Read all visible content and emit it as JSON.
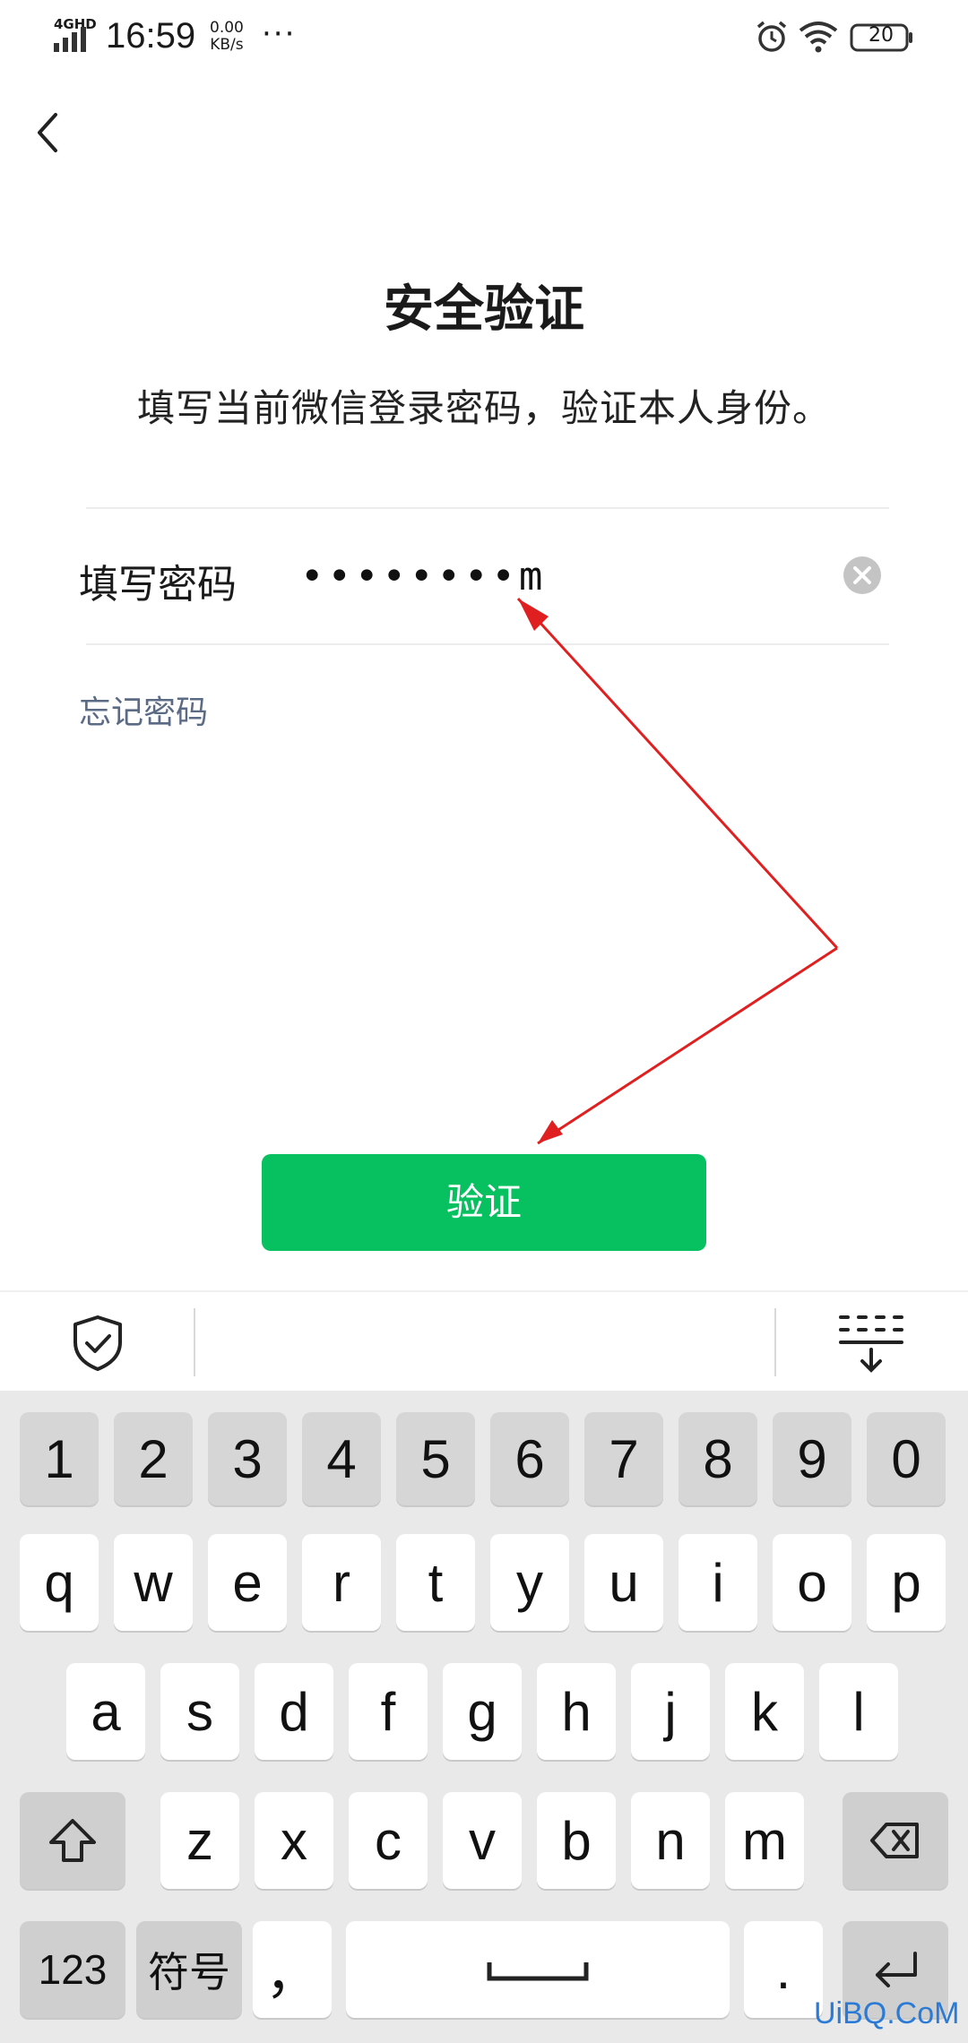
{
  "status_bar": {
    "network": "4GHD",
    "time": "16:59",
    "speed_value": "0.00",
    "speed_unit": "KB/s",
    "more": "···",
    "battery": "20"
  },
  "header": {
    "title": "安全验证",
    "subtitle": "填写当前微信登录密码，验证本人身份。"
  },
  "form": {
    "password_label": "填写密码",
    "password_value": "••••••••m",
    "forgot_link": "忘记密码",
    "verify_button": "验证"
  },
  "keyboard": {
    "row_numbers": [
      "1",
      "2",
      "3",
      "4",
      "5",
      "6",
      "7",
      "8",
      "9",
      "0"
    ],
    "row1": [
      "q",
      "w",
      "e",
      "r",
      "t",
      "y",
      "u",
      "i",
      "o",
      "p"
    ],
    "row2": [
      "a",
      "s",
      "d",
      "f",
      "g",
      "h",
      "j",
      "k",
      "l"
    ],
    "row3": [
      "z",
      "x",
      "c",
      "v",
      "b",
      "n",
      "m"
    ],
    "numeric_key": "123",
    "symbol_key": "符号",
    "comma_key": "，",
    "period_key": "."
  },
  "watermark": "UiBQ.CoM",
  "colors": {
    "accent_green": "#07c160",
    "link_gray_blue": "#5b6b86",
    "annotation_red": "#e02020"
  },
  "icons": [
    "back-icon",
    "clear-icon",
    "shield-icon",
    "collapse-keyboard-icon",
    "shift-icon",
    "backspace-icon",
    "enter-icon",
    "alarm-icon",
    "wifi-icon",
    "battery-icon"
  ]
}
